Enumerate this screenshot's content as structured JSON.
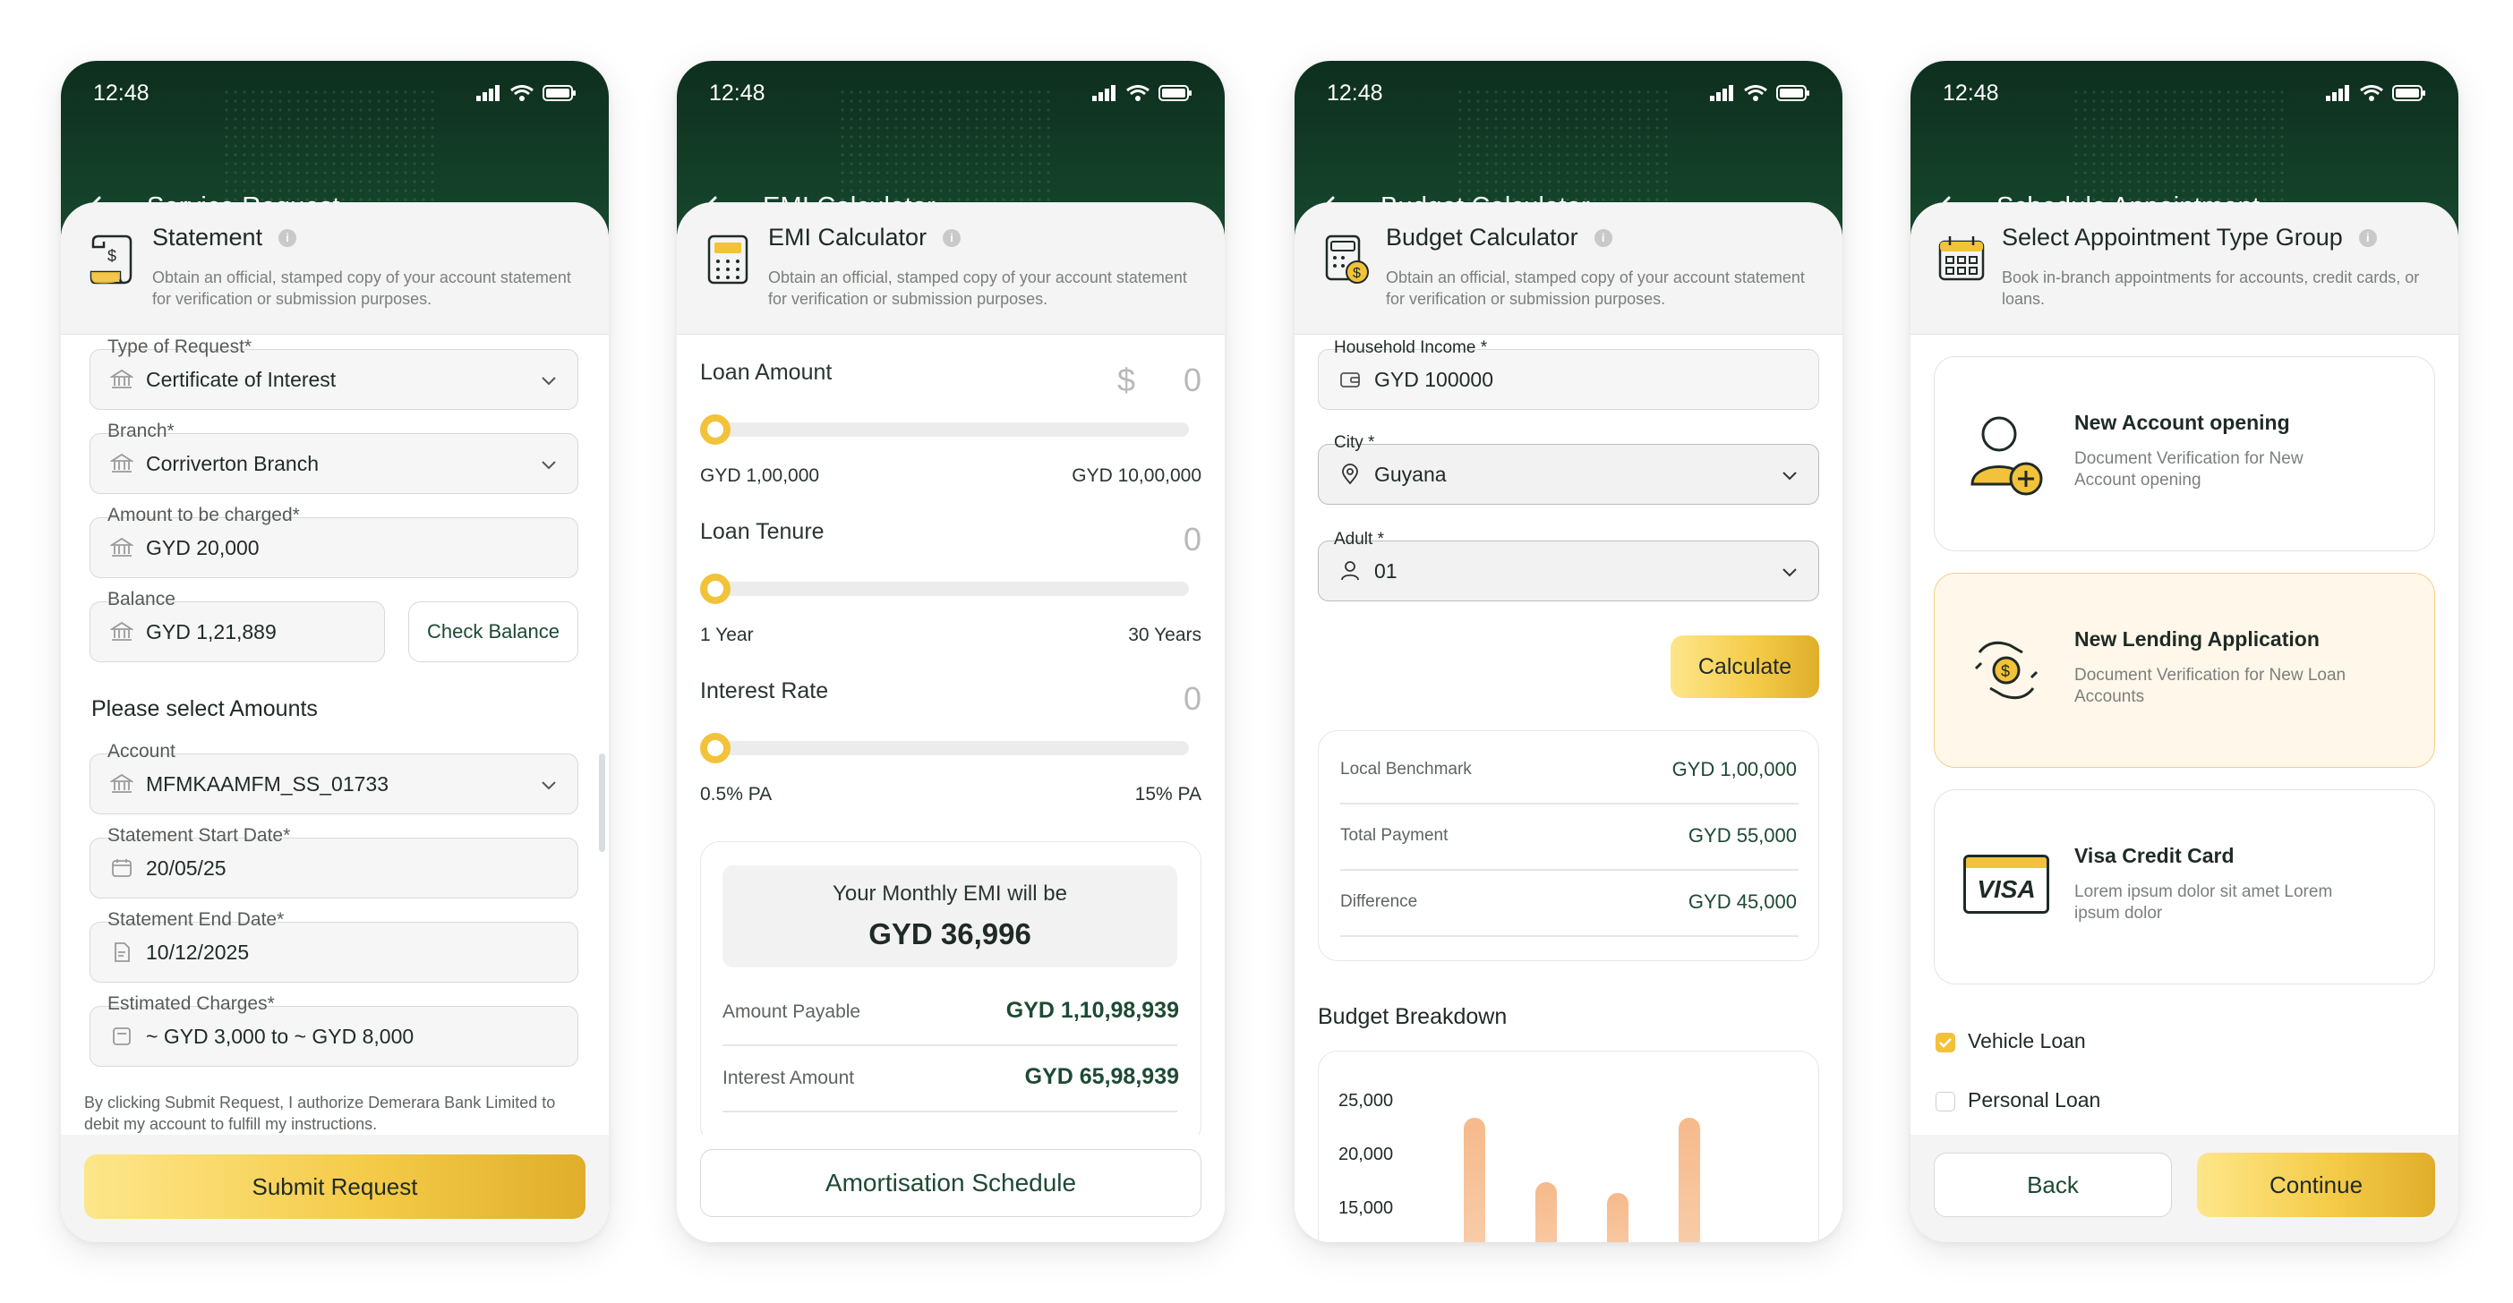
{
  "status": {
    "time": "12:48"
  },
  "screens": {
    "service": {
      "title": "Service Request",
      "intro_title": "Statement",
      "intro_desc": "Obtain an official, stamped copy of your account statement for verification or submission purposes.",
      "type_label": "Type of Request*",
      "type_value": "Certificate of Interest",
      "branch_label": "Branch*",
      "branch_value": "Corriverton Branch",
      "amount_label": "Amount to be charged*",
      "amount_value": "GYD 20,000",
      "balance_label": "Balance",
      "balance_value": "GYD 1,21,889",
      "check_balance": "Check Balance",
      "select_amounts": "Please select Amounts",
      "account_label": "Account",
      "account_value": "MFMKAAMFM_SS_01733",
      "start_label": "Statement Start Date*",
      "start_value": "20/05/25",
      "end_label": "Statement End Date*",
      "end_value": "10/12/2025",
      "charges_label": "Estimated Charges*",
      "charges_value": "~ GYD 3,000 to ~ GYD 8,000",
      "consent": "By clicking Submit Request, I authorize Demerara Bank Limited to debit my account to fulfill my instructions.",
      "submit": "Submit Request"
    },
    "emi": {
      "title": "EMI Calculator",
      "intro_title": "EMI Calculator",
      "intro_desc": "Obtain an official, stamped copy of your account statement for verification or submission purposes.",
      "loan_amount_label": "Loan Amount",
      "currency_symbol": "$",
      "loan_amount_value": "0",
      "loan_amount_fill": 0,
      "loan_min": "GYD 1,00,000",
      "loan_max": "GYD 10,00,000",
      "tenure_label": "Loan Tenure",
      "tenure_value": "0",
      "tenure_fill": 0,
      "tenure_min": "1 Year",
      "tenure_max": "30 Years",
      "rate_label": "Interest Rate",
      "rate_value": "0",
      "rate_fill": 0,
      "rate_min": "0.5% PA",
      "rate_max": "15% PA",
      "monthly_label": "Your Monthly EMI will be",
      "monthly_value": "GYD 36,996",
      "payable_label": "Amount Payable",
      "payable_value": "GYD 1,10,98,939",
      "interest_label": "Interest Amount",
      "interest_value": "GYD 65,98,939",
      "amort": "Amortisation Schedule"
    },
    "budget": {
      "title": "Budget Calculator",
      "intro_title": "Budget Calculator",
      "intro_desc": "Obtain an official, stamped copy of your account statement for verification or submission purposes.",
      "income_label": "Household Income *",
      "income_value": "GYD 100000",
      "city_label": "City *",
      "city_value": "Guyana",
      "adult_label": "Adult *",
      "adult_value": "01",
      "calculate": "Calculate",
      "bench_label": "Local Benchmark",
      "bench_value": "GYD 1,00,000",
      "total_label": "Total Payment",
      "total_value": "GYD  55,000",
      "diff_label": "Difference",
      "diff_value": "GYD 45,000",
      "breakdown": "Budget Breakdown"
    },
    "appointment": {
      "title": "Schedule Appointment",
      "intro_title": "Select Appointment Type Group",
      "intro_desc": "Book in-branch appointments for accounts, credit cards, or loans.",
      "options": [
        {
          "title": "New Account opening",
          "desc": "Document Verification for New Account opening"
        },
        {
          "title": "New Lending Application",
          "desc": "Document Verification for New Loan Accounts"
        },
        {
          "title": "Visa Credit Card",
          "desc": "Lorem ipsum dolor sit amet Lorem ipsum dolor"
        }
      ],
      "visa_logo": "VISA",
      "check_vehicle": "Vehicle Loan",
      "check_personal": "Personal Loan",
      "back": "Back",
      "continue": "Continue"
    }
  },
  "chart_data": {
    "type": "bar",
    "title": "Budget Breakdown",
    "y_ticks": [
      "25,000",
      "20,000",
      "15,000"
    ],
    "ylim": [
      15000,
      25000
    ],
    "values": [
      23500,
      17500,
      16500,
      23500
    ],
    "color": "#f6b98a"
  },
  "colors": {
    "brand_dark": "#0e2f1e",
    "accent_gold": "#f2c23a",
    "text_green": "#1d4a33"
  }
}
